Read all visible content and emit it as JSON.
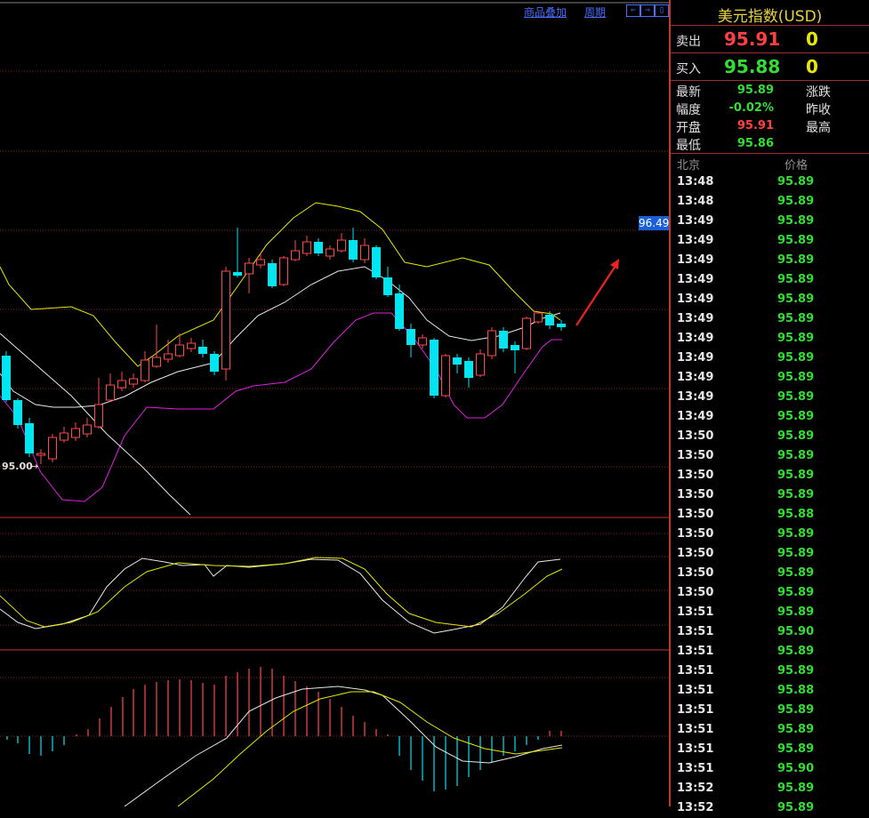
{
  "toolbar": {
    "overlay_label": "商品叠加",
    "period_label": "周期",
    "nav_left": "⇐",
    "nav_right": "⇒",
    "nav_list": "▯"
  },
  "chart": {
    "last_price_tag": "96.49",
    "min_marker": "95.00",
    "colors": {
      "up": "#ff4a4a",
      "down": "#00e5f0",
      "ma_white": "#e8e8e8",
      "boll_upper": "#e8e800",
      "boll_lower": "#e020e0",
      "grid": "#8a1f1f",
      "arrow": "#ee2222"
    }
  },
  "quote": {
    "title": "美元指数(USD)",
    "sell_label": "卖出",
    "sell_price": "95.91",
    "sell_vol": "0",
    "buy_label": "买入",
    "buy_price": "95.88",
    "buy_vol": "0"
  },
  "stats": {
    "latest_label": "最新",
    "latest_value": "95.89",
    "change_label": "涨跌",
    "range_label": "幅度",
    "range_value": "-0.02%",
    "prev_close_label": "昨收",
    "open_label": "开盘",
    "open_value": "95.91",
    "high_label": "最高",
    "low_label": "最低",
    "low_value": "95.86"
  },
  "ticks": {
    "col_time": "北京",
    "col_price": "价格",
    "rows": [
      {
        "time": "13:48",
        "price": "95.89"
      },
      {
        "time": "13:48",
        "price": "95.89"
      },
      {
        "time": "13:49",
        "price": "95.89"
      },
      {
        "time": "13:49",
        "price": "95.89"
      },
      {
        "time": "13:49",
        "price": "95.89"
      },
      {
        "time": "13:49",
        "price": "95.89"
      },
      {
        "time": "13:49",
        "price": "95.89"
      },
      {
        "time": "13:49",
        "price": "95.89"
      },
      {
        "time": "13:49",
        "price": "95.89"
      },
      {
        "time": "13:49",
        "price": "95.89"
      },
      {
        "time": "13:49",
        "price": "95.89"
      },
      {
        "time": "13:49",
        "price": "95.89"
      },
      {
        "time": "13:49",
        "price": "95.89"
      },
      {
        "time": "13:50",
        "price": "95.89"
      },
      {
        "time": "13:50",
        "price": "95.89"
      },
      {
        "time": "13:50",
        "price": "95.89"
      },
      {
        "time": "13:50",
        "price": "95.89"
      },
      {
        "time": "13:50",
        "price": "95.88"
      },
      {
        "time": "13:50",
        "price": "95.89"
      },
      {
        "time": "13:50",
        "price": "95.89"
      },
      {
        "time": "13:50",
        "price": "95.89"
      },
      {
        "time": "13:50",
        "price": "95.89"
      },
      {
        "time": "13:51",
        "price": "95.89"
      },
      {
        "time": "13:51",
        "price": "95.90"
      },
      {
        "time": "13:51",
        "price": "95.89"
      },
      {
        "time": "13:51",
        "price": "95.89"
      },
      {
        "time": "13:51",
        "price": "95.88"
      },
      {
        "time": "13:51",
        "price": "95.89"
      },
      {
        "time": "13:51",
        "price": "95.89"
      },
      {
        "time": "13:51",
        "price": "95.89"
      },
      {
        "time": "13:51",
        "price": "95.90"
      },
      {
        "time": "13:52",
        "price": "95.89"
      },
      {
        "time": "13:52",
        "price": "95.89"
      }
    ]
  }
}
